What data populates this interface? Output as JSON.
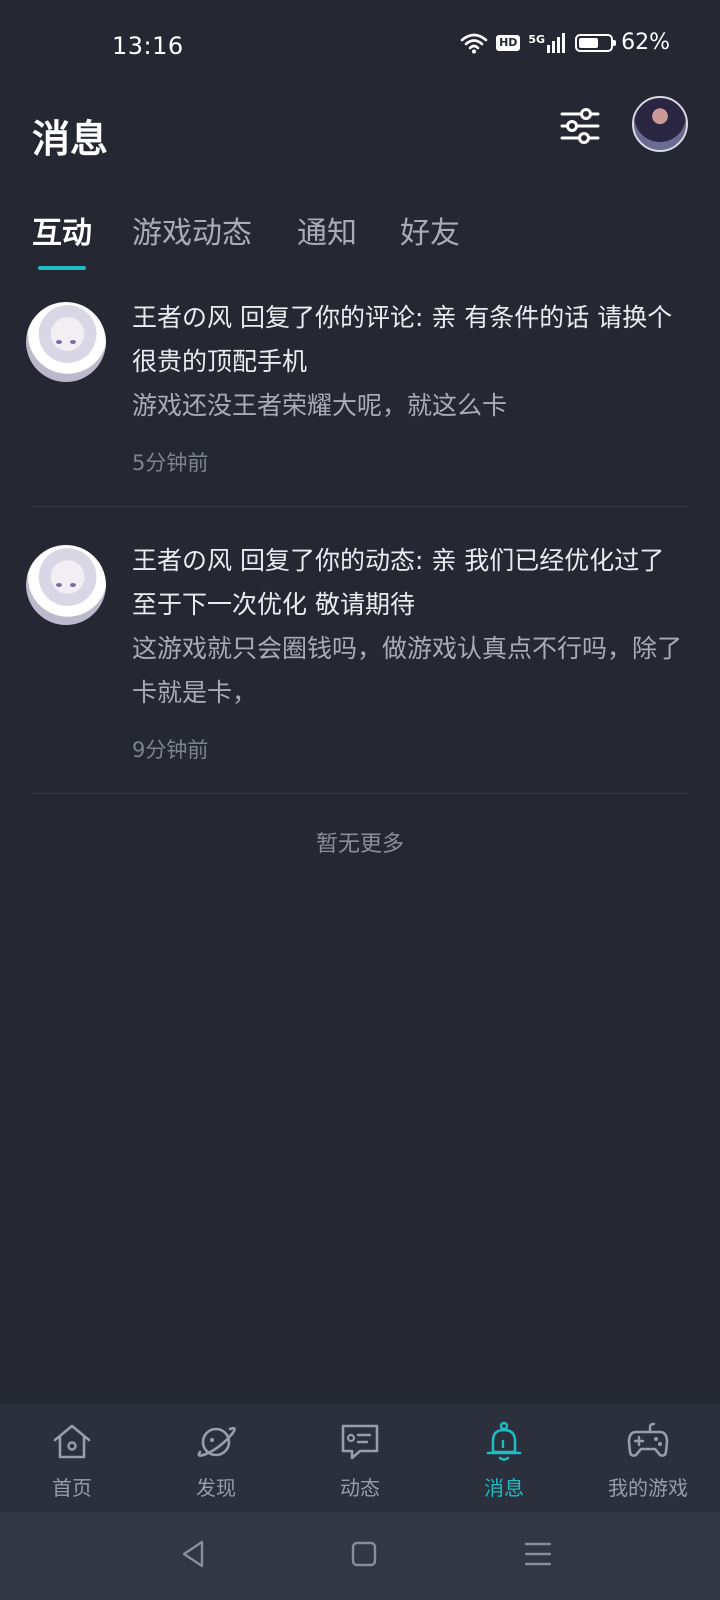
{
  "status_bar": {
    "time": "13:16",
    "network": "5G",
    "hd": "HD",
    "battery_percent": "62%",
    "battery_level": 0.62
  },
  "header": {
    "title": "消息"
  },
  "tabs": [
    {
      "label": "互动",
      "active": true
    },
    {
      "label": "游戏动态",
      "active": false
    },
    {
      "label": "通知",
      "active": false
    },
    {
      "label": "好友",
      "active": false
    }
  ],
  "messages": [
    {
      "title": "王者の风 回复了你的评论: 亲 有条件的话 请换个很贵的顶配手机",
      "content": "游戏还没王者荣耀大呢，就这么卡",
      "time": "5分钟前"
    },
    {
      "title": "王者の风 回复了你的动态: 亲 我们已经优化过了 至于下一次优化 敬请期待",
      "content": "这游戏就只会圈钱吗，做游戏认真点不行吗，除了卡就是卡，",
      "time": "9分钟前"
    }
  ],
  "list_footer": "暂无更多",
  "bottom_nav": [
    {
      "label": "首页",
      "icon": "home-icon",
      "active": false
    },
    {
      "label": "发现",
      "icon": "planet-icon",
      "active": false
    },
    {
      "label": "动态",
      "icon": "chat-icon",
      "active": false
    },
    {
      "label": "消息",
      "icon": "bell-icon",
      "active": true
    },
    {
      "label": "我的游戏",
      "icon": "gamepad-icon",
      "active": false
    }
  ],
  "colors": {
    "background": "#252733",
    "accent": "#1fbcc4",
    "nav_background": "#2c2f3c"
  }
}
